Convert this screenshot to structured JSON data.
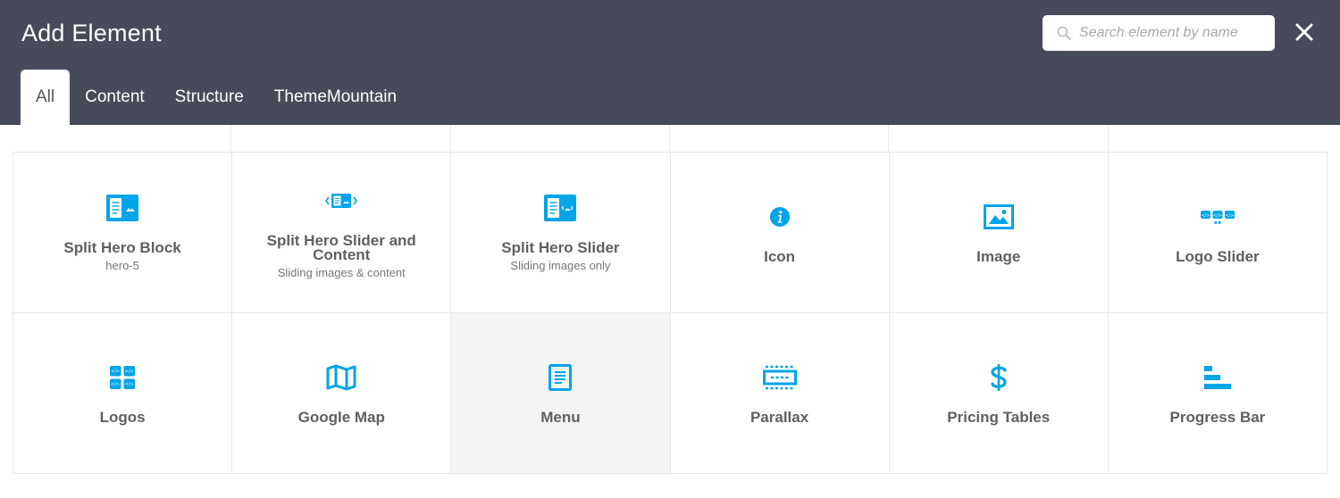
{
  "header": {
    "title": "Add Element",
    "search_placeholder": "Search element by name",
    "search_value": "",
    "search_icon": "search-icon",
    "close_icon": "close-icon"
  },
  "tabs": [
    {
      "label": "All",
      "active": true
    },
    {
      "label": "Content",
      "active": false
    },
    {
      "label": "Structure",
      "active": false
    },
    {
      "label": "ThemeMountain",
      "active": false
    }
  ],
  "colors": {
    "header_bg": "#474b59",
    "accent": "#00a4e8",
    "hover_bg": "#f4f4f4"
  },
  "elements": [
    {
      "name": "Split Hero Block",
      "desc": "hero-5",
      "icon": "split-hero-block-icon"
    },
    {
      "name": "Split Hero Slider and Content",
      "desc": "Sliding images & content",
      "icon": "split-hero-slider-content-icon"
    },
    {
      "name": "Split Hero Slider",
      "desc": "Sliding images only",
      "icon": "split-hero-slider-icon"
    },
    {
      "name": "Icon",
      "desc": "",
      "icon": "info-icon"
    },
    {
      "name": "Image",
      "desc": "",
      "icon": "image-icon"
    },
    {
      "name": "Logo Slider",
      "desc": "",
      "icon": "logo-slider-icon"
    },
    {
      "name": "Logos",
      "desc": "",
      "icon": "logos-icon"
    },
    {
      "name": "Google Map",
      "desc": "",
      "icon": "map-icon"
    },
    {
      "name": "Menu",
      "desc": "",
      "icon": "menu-icon"
    },
    {
      "name": "Parallax",
      "desc": "",
      "icon": "parallax-icon"
    },
    {
      "name": "Pricing Tables",
      "desc": "",
      "icon": "dollar-icon"
    },
    {
      "name": "Progress Bar",
      "desc": "",
      "icon": "progress-bar-icon"
    }
  ]
}
